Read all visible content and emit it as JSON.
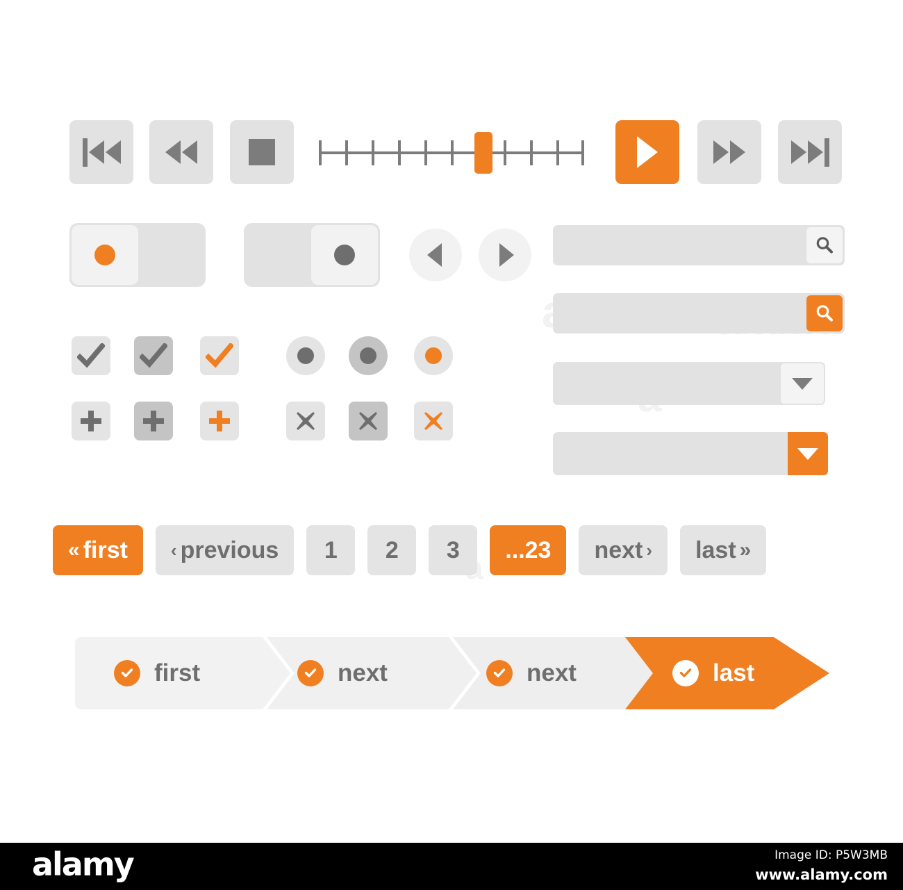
{
  "palette": {
    "accent": "#f07f22",
    "tile_light": "#e4e4e4",
    "tile_dark": "#c4c4c4",
    "field_bg": "#e2e2e2",
    "icon_gray": "#7c7c7c",
    "text_gray": "#6e6e6e",
    "knob_bg": "#f2f2f2",
    "page_bg": "#ffffff",
    "footer_bg": "#000000"
  },
  "media_controls": [
    {
      "name": "skip-to-start-button",
      "icon": "skip-backward-icon",
      "style": "gray"
    },
    {
      "name": "rewind-button",
      "icon": "rewind-icon",
      "style": "gray"
    },
    {
      "name": "stop-button",
      "icon": "stop-icon",
      "style": "gray"
    },
    {
      "name": "play-button",
      "icon": "play-icon",
      "style": "accent"
    },
    {
      "name": "fast-forward-button",
      "icon": "fast-forward-icon",
      "style": "gray"
    },
    {
      "name": "skip-to-end-button",
      "icon": "skip-forward-icon",
      "style": "gray"
    }
  ],
  "slider": {
    "label": "timeline-slider",
    "tick_count": 11,
    "handle_position_percent": 60,
    "value": 6,
    "min": 0,
    "max": 10
  },
  "toggles": [
    {
      "name": "toggle-switch-on",
      "state": "on",
      "knob_side": "left",
      "dot_color": "#f07f22"
    },
    {
      "name": "toggle-switch-off",
      "state": "off",
      "knob_side": "right",
      "dot_color": "#6e6e6e"
    }
  ],
  "circle_nav": [
    {
      "name": "circle-previous-button",
      "icon": "triangle-left-icon"
    },
    {
      "name": "circle-next-button",
      "icon": "triangle-right-icon"
    }
  ],
  "search_fields": [
    {
      "name": "search-input-plain",
      "value": "",
      "placeholder": "",
      "button_icon": "search-icon",
      "button_style": "plain"
    },
    {
      "name": "search-input-accent",
      "value": "",
      "placeholder": "",
      "button_icon": "search-icon",
      "button_style": "accent"
    }
  ],
  "dropdowns": [
    {
      "name": "select-plain",
      "value": "",
      "placeholder": "",
      "button_icon": "chevron-down-icon",
      "button_style": "plain"
    },
    {
      "name": "select-accent",
      "value": "",
      "placeholder": "",
      "button_icon": "chevron-down-icon",
      "button_style": "accent"
    }
  ],
  "checkboxes": [
    {
      "name": "checkbox-checked-light",
      "bg": "light",
      "mark_color": "#6e6e6e",
      "checked": true
    },
    {
      "name": "checkbox-checked-dark",
      "bg": "dark",
      "mark_color": "#6e6e6e",
      "checked": true
    },
    {
      "name": "checkbox-checked-accent",
      "bg": "light",
      "mark_color": "#f07f22",
      "checked": true
    }
  ],
  "radios": [
    {
      "name": "radio-selected-light",
      "bg": "light",
      "dot_color": "#6e6e6e",
      "selected": true
    },
    {
      "name": "radio-selected-dark",
      "bg": "dark",
      "dot_color": "#6e6e6e",
      "selected": true
    },
    {
      "name": "radio-selected-accent",
      "bg": "light",
      "dot_color": "#f07f22",
      "selected": true
    }
  ],
  "plus_buttons": [
    {
      "name": "add-button-light",
      "bg": "light",
      "mark_color": "#6e6e6e"
    },
    {
      "name": "add-button-dark",
      "bg": "dark",
      "mark_color": "#6e6e6e"
    },
    {
      "name": "add-button-accent",
      "bg": "light",
      "mark_color": "#f07f22"
    }
  ],
  "close_buttons": [
    {
      "name": "close-button-light",
      "bg": "light",
      "mark_color": "#6e6e6e"
    },
    {
      "name": "close-button-dark",
      "bg": "dark",
      "mark_color": "#6e6e6e"
    },
    {
      "name": "close-button-accent",
      "bg": "light",
      "mark_color": "#f07f22"
    }
  ],
  "pagination": {
    "items": [
      {
        "name": "page-first",
        "label": "first",
        "chevron_pre": "«",
        "chevron_post": "",
        "active": true,
        "kind": "text"
      },
      {
        "name": "page-previous",
        "label": "previous",
        "chevron_pre": "‹",
        "chevron_post": "",
        "active": false,
        "kind": "text"
      },
      {
        "name": "page-1",
        "label": "1",
        "chevron_pre": "",
        "chevron_post": "",
        "active": false,
        "kind": "num"
      },
      {
        "name": "page-2",
        "label": "2",
        "chevron_pre": "",
        "chevron_post": "",
        "active": false,
        "kind": "num"
      },
      {
        "name": "page-3",
        "label": "3",
        "chevron_pre": "",
        "chevron_post": "",
        "active": false,
        "kind": "num"
      },
      {
        "name": "page-23",
        "label": "...23",
        "chevron_pre": "",
        "chevron_post": "",
        "active": true,
        "kind": "text"
      },
      {
        "name": "page-next",
        "label": "next",
        "chevron_pre": "",
        "chevron_post": "›",
        "active": false,
        "kind": "text"
      },
      {
        "name": "page-last",
        "label": "last",
        "chevron_pre": "",
        "chevron_post": "»",
        "active": false,
        "kind": "text"
      }
    ]
  },
  "wizard": {
    "steps": [
      {
        "name": "wizard-step-first",
        "label": "first",
        "state": "done",
        "icon": "check-circle-icon"
      },
      {
        "name": "wizard-step-next-1",
        "label": "next",
        "state": "done",
        "icon": "check-circle-icon"
      },
      {
        "name": "wizard-step-next-2",
        "label": "next",
        "state": "done",
        "icon": "check-circle-icon"
      },
      {
        "name": "wizard-step-last",
        "label": "last",
        "state": "current",
        "icon": "check-circle-icon"
      }
    ]
  },
  "watermark": {
    "text": "alamy",
    "fragments": [
      "a",
      "alamu",
      "a",
      "a",
      "a",
      "a",
      "a",
      "a",
      "a",
      "a"
    ]
  },
  "footer": {
    "logo": "alamy",
    "image_id": "Image ID: P5W3MB",
    "site": "www.alamy.com"
  }
}
